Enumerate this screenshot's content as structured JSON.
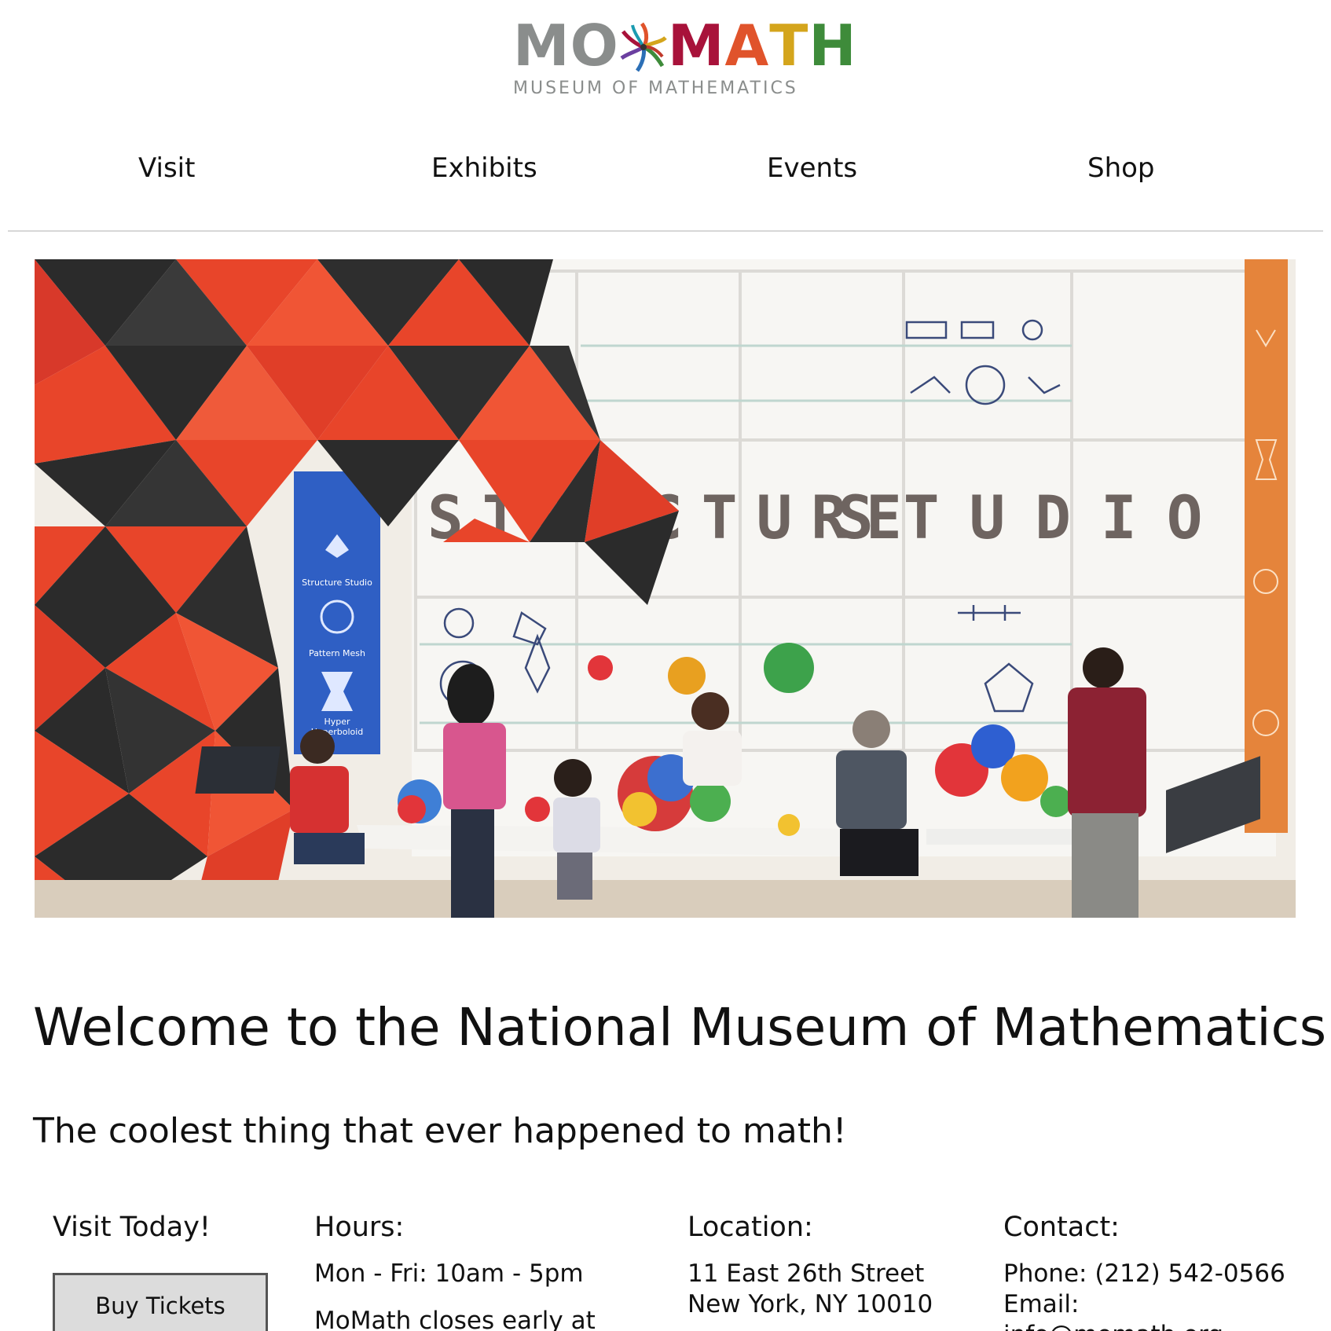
{
  "logo": {
    "mo": "MO",
    "math": [
      "M",
      "A",
      "T",
      "H"
    ],
    "subtitle": "MUSEUM OF MATHEMATICS"
  },
  "nav": {
    "items": [
      "Visit",
      "Exhibits",
      "Events",
      "Shop"
    ]
  },
  "hero": {
    "sign_text": "STRUCTURE STUDIO",
    "banner_labels": [
      "Structure Studio",
      "Pattern Mesh",
      "Hyper Hyperboloid"
    ]
  },
  "main": {
    "title": "Welcome to the National Museum of Mathematics!",
    "tagline": "The coolest thing that ever happened to math!"
  },
  "visit": {
    "title": "Visit Today!",
    "button": "Buy Tickets"
  },
  "hours": {
    "title": "Hours:",
    "line1": "Mon - Fri: 10am - 5pm",
    "line2": "MoMath closes early at"
  },
  "location": {
    "title": "Location:",
    "line1": "11 East 26th Street",
    "line2": "New York, NY 10010"
  },
  "contact": {
    "title": "Contact:",
    "phone": "Phone: (212) 542-0566",
    "email_label": "Email:",
    "email": "info@momath.org"
  },
  "colors": {
    "logo_gray": "#8a8d8c",
    "logo_crimson": "#a8123a",
    "logo_orange": "#e0532b",
    "logo_gold": "#d4a51c",
    "logo_green": "#3e8b3a",
    "sculpture_red": "#e8452a",
    "sculpture_dark": "#2b2b2b"
  }
}
